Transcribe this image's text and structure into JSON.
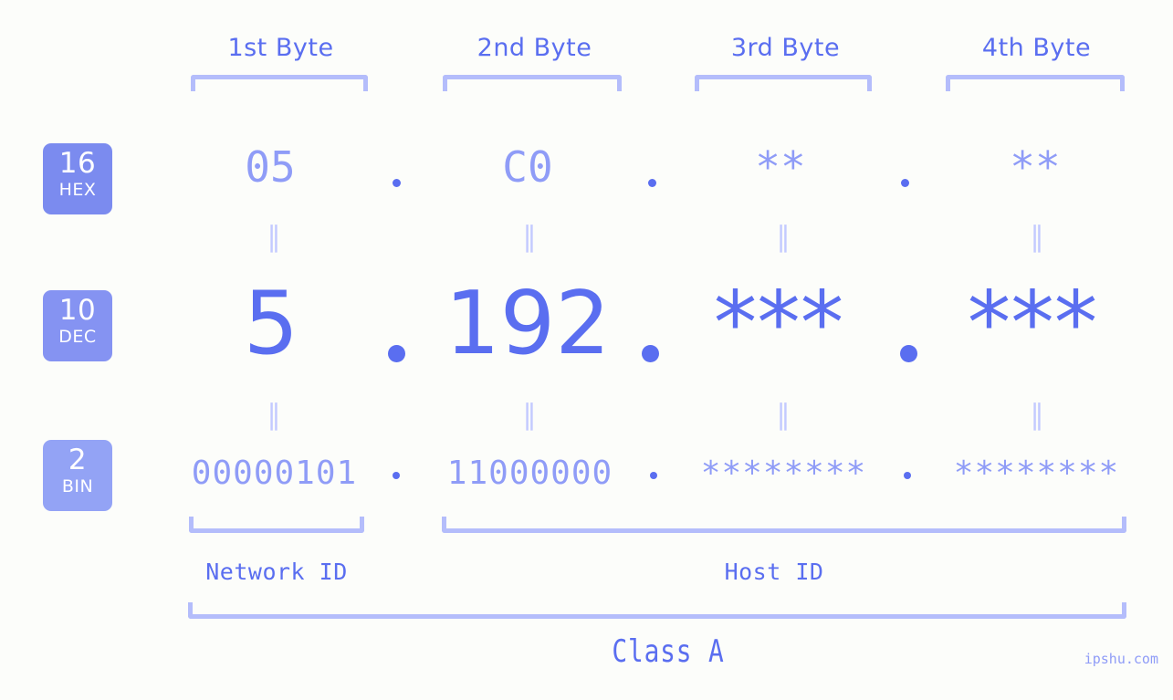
{
  "colors": {
    "background": "#fcfdfa",
    "accent_strong": "#5a6ef0",
    "accent_mid": "#8f9cf7",
    "accent_light": "#b4bdfb",
    "badge_hex": "#7b8bef",
    "badge_dec": "#8593f2",
    "badge_bin": "#93a3f5"
  },
  "headers": {
    "bytes": [
      {
        "label": "1st Byte"
      },
      {
        "label": "2nd Byte"
      },
      {
        "label": "3rd Byte"
      },
      {
        "label": "4th Byte"
      }
    ]
  },
  "bases": [
    {
      "number": "16",
      "name": "HEX"
    },
    {
      "number": "10",
      "name": "DEC"
    },
    {
      "number": "2",
      "name": "BIN"
    }
  ],
  "rows": {
    "hex": {
      "base_number": "16",
      "base_name": "HEX",
      "values": [
        "05",
        "C0",
        "**",
        "**"
      ],
      "separator": "."
    },
    "dec": {
      "base_number": "10",
      "base_name": "DEC",
      "values": [
        "5",
        "192",
        "***",
        "***"
      ],
      "separator": "."
    },
    "bin": {
      "base_number": "2",
      "base_name": "BIN",
      "values": [
        "00000101",
        "11000000",
        "********",
        "********"
      ],
      "separator": "."
    }
  },
  "equals_glyph": "∥",
  "segments": {
    "network_id": "Network ID",
    "host_id": "Host ID"
  },
  "class": {
    "label": "Class A"
  },
  "watermark": "ipshu.com"
}
